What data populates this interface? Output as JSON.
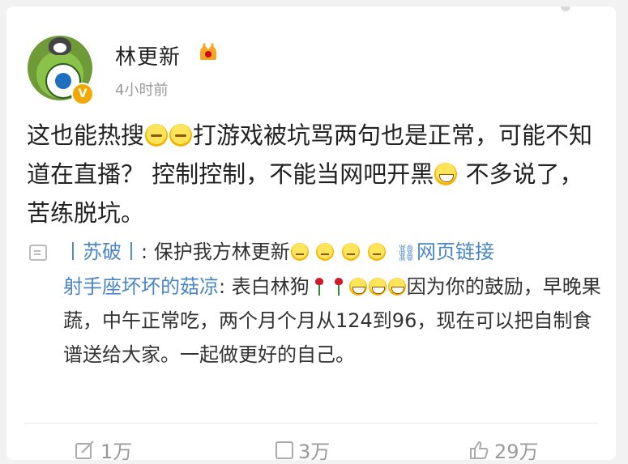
{
  "post": {
    "username": "林更新",
    "timestamp": "4小时前",
    "text_parts": {
      "p1": "这也能热搜",
      "p2": "打游戏被坑骂两句也是正常，可能不知道在直播？ 控制控制，不能当网吧开黑",
      "p3": " 不多说了，苦练脱坑。"
    }
  },
  "comments": [
    {
      "user": "丨苏破丨",
      "separator": ": ",
      "text": "保护我方林更新",
      "link_label": "网页链接"
    },
    {
      "user": "射手座坏坏的菇凉",
      "separator": ": ",
      "text_a": "表白林狗",
      "text_b": "因为你的鼓励，早晚果蔬，中午正常吃，两个月个月从124到96，现在可以把自制食谱送给大家。一起做更好的自己。"
    }
  ],
  "footer": {
    "repost_count": "1万",
    "comment_count": "3万",
    "like_count": "29万"
  },
  "icons": {
    "crown": "crown-icon",
    "verified": "v-badge-icon",
    "link": "link-icon",
    "repost": "repost-icon",
    "comment": "comment-icon",
    "like": "thumbs-up-icon"
  },
  "colors": {
    "link": "#4a86c4",
    "muted": "#999999",
    "badge": "#f1a800"
  }
}
